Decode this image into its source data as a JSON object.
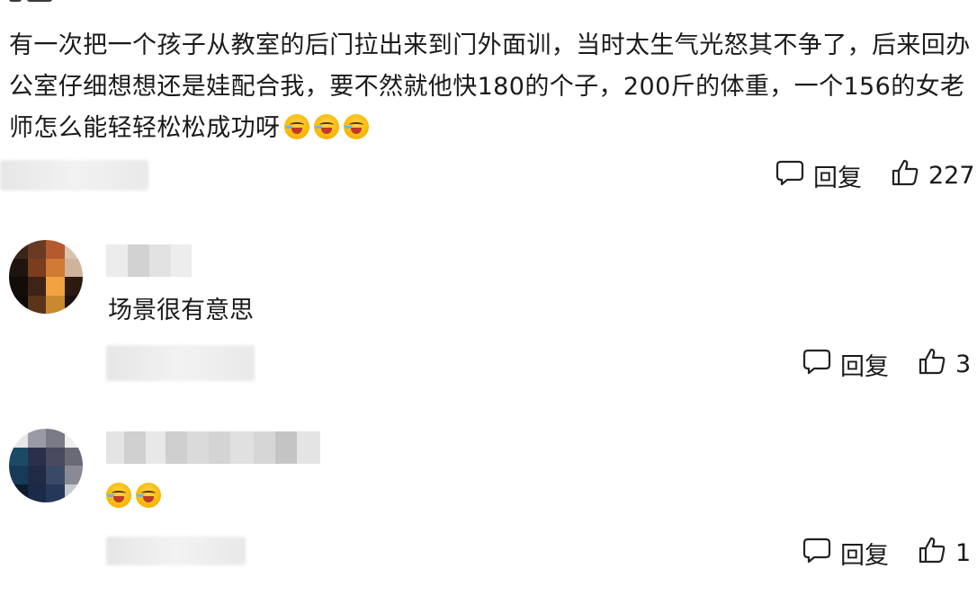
{
  "main_comment": {
    "text": "有一次把一个孩子从教室的后门拉出来到门外面训，当时太生气光怒其不争了，后来回办公室仔细想想还是娃配合我，要不然就他快180的个子，200斤的体重，一个156的女老师怎么能轻轻松松成功呀",
    "emojis": [
      "laugh-cry-emoji",
      "laugh-cry-emoji",
      "laugh-cry-emoji"
    ],
    "reply_label": "回复",
    "like_count": "227"
  },
  "replies": [
    {
      "text": "场景很有意思",
      "reply_label": "回复",
      "like_count": "3"
    },
    {
      "text": "",
      "emojis": [
        "laugh-cry-emoji",
        "laugh-cry-emoji"
      ],
      "reply_label": "回复",
      "like_count": "1"
    }
  ],
  "colors": {
    "text": "#1a1a1a",
    "background": "#ffffff",
    "blur_gray": "#e6e6e6"
  }
}
